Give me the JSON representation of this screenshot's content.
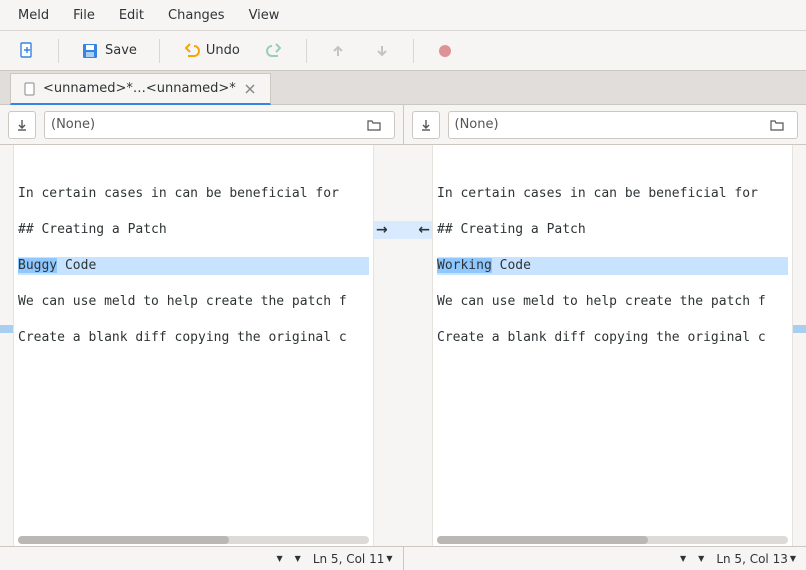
{
  "menubar": {
    "items": [
      "Meld",
      "File",
      "Edit",
      "Changes",
      "View"
    ]
  },
  "toolbar": {
    "save_label": "Save",
    "undo_label": "Undo"
  },
  "tab": {
    "label": "<unnamed>*…<unnamed>*"
  },
  "fileselectors": {
    "left_text": "(None)",
    "right_text": "(None)"
  },
  "panes": {
    "left": {
      "lines": [
        "In certain cases in can be beneficial for",
        "",
        "## Creating a Patch",
        "",
        {
          "changed": true,
          "diff_word": "Buggy",
          "rest": " Code"
        },
        "",
        "We can use meld to help create the patch f",
        "",
        "Create a blank diff copying the original c"
      ]
    },
    "right": {
      "lines": [
        "In certain cases in can be beneficial for",
        "",
        "## Creating a Patch",
        "",
        {
          "changed": true,
          "diff_word": "Working",
          "rest": " Code"
        },
        "",
        "We can use meld to help create the patch f",
        "",
        "Create a blank diff copying the original c"
      ]
    }
  },
  "statusbar": {
    "left_pos": "Ln 5, Col 11",
    "right_pos": "Ln 5, Col 13"
  }
}
